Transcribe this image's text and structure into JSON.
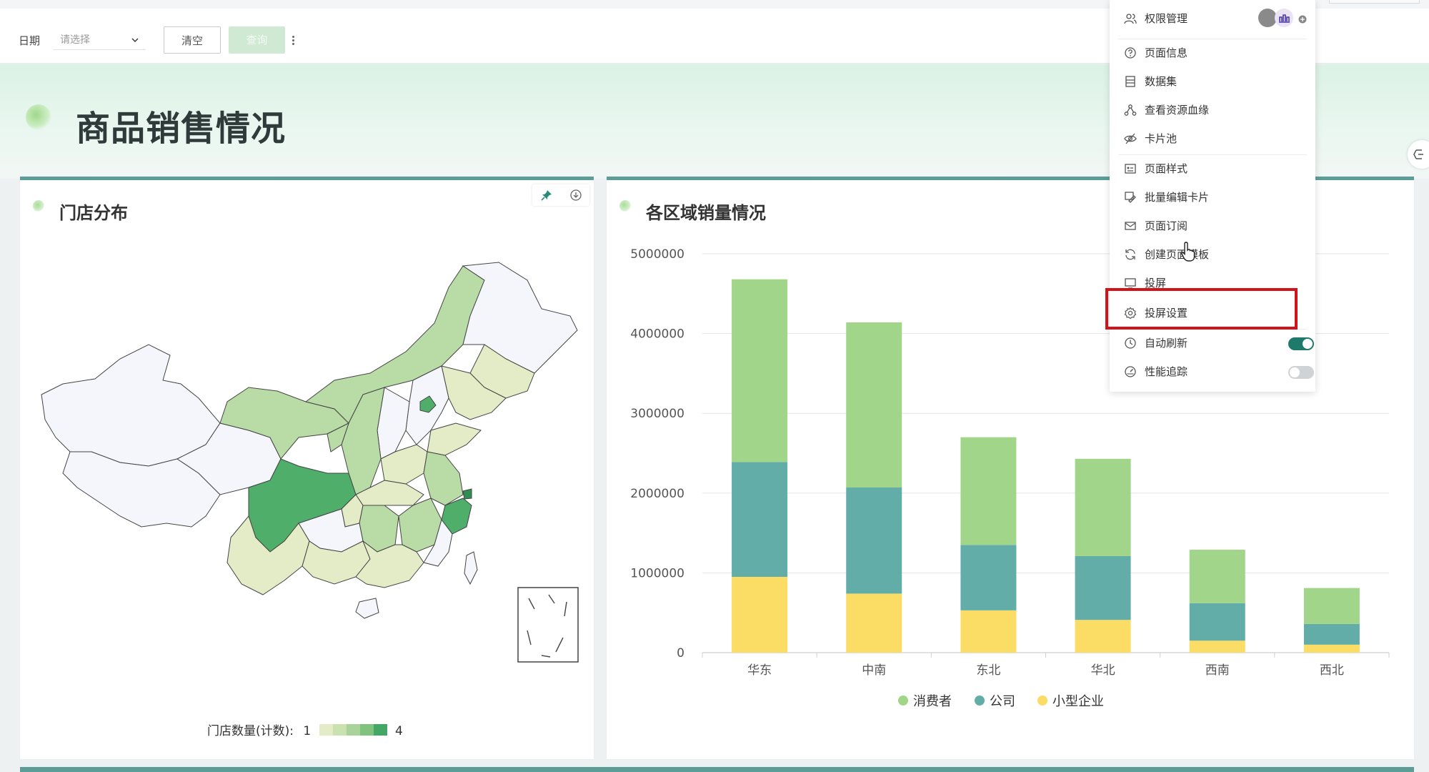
{
  "filter": {
    "date_label": "日期",
    "date_placeholder": "请选择",
    "clear_label": "清空",
    "query_label": "查询"
  },
  "page": {
    "title": "商品销售情况"
  },
  "map_card": {
    "title": "门店分布",
    "legend_title": "门店数量(计数):",
    "legend_min": "1",
    "legend_max": "4",
    "legend_colors": [
      "#e3ecc7",
      "#c9e2b0",
      "#a9d39b",
      "#7fc37f",
      "#43a865"
    ]
  },
  "chart_card": {
    "title": "各区域销量情况"
  },
  "chart_data": {
    "type": "bar",
    "stacked": true,
    "categories": [
      "华东",
      "中南",
      "东北",
      "华北",
      "西南",
      "西北"
    ],
    "series": [
      {
        "name": "小型企业",
        "color": "#fbdc64",
        "values": [
          950000,
          740000,
          530000,
          410000,
          150000,
          100000
        ]
      },
      {
        "name": "公司",
        "color": "#62ada8",
        "values": [
          1440000,
          1330000,
          820000,
          800000,
          470000,
          260000
        ]
      },
      {
        "name": "消费者",
        "color": "#a1d589",
        "values": [
          2290000,
          2070000,
          1350000,
          1220000,
          670000,
          450000
        ]
      }
    ],
    "ylim": [
      0,
      5000000
    ],
    "yticks": [
      "0",
      "1000000",
      "2000000",
      "3000000",
      "4000000",
      "5000000"
    ],
    "grid": true,
    "legend_position": "bottom"
  },
  "menu": {
    "items": [
      {
        "label": "权限管理",
        "icon": "users-icon"
      },
      {
        "label": "页面信息",
        "icon": "question-circle-icon"
      },
      {
        "label": "数据集",
        "icon": "dataset-icon"
      },
      {
        "label": "查看资源血缘",
        "icon": "lineage-icon"
      },
      {
        "label": "卡片池",
        "icon": "eye-off-icon"
      },
      {
        "label": "页面样式",
        "icon": "style-icon"
      },
      {
        "label": "批量编辑卡片",
        "icon": "batch-edit-icon"
      },
      {
        "label": "页面订阅",
        "icon": "mail-icon"
      },
      {
        "label": "创建页面模板",
        "icon": "refresh-icon"
      },
      {
        "label": "投屏",
        "icon": "cast-icon"
      },
      {
        "label": "投屏设置",
        "icon": "gear-icon"
      },
      {
        "label": "自动刷新",
        "icon": "clock-icon",
        "toggle": "on"
      },
      {
        "label": "性能追踪",
        "icon": "gauge-icon",
        "toggle": "off"
      }
    ]
  }
}
